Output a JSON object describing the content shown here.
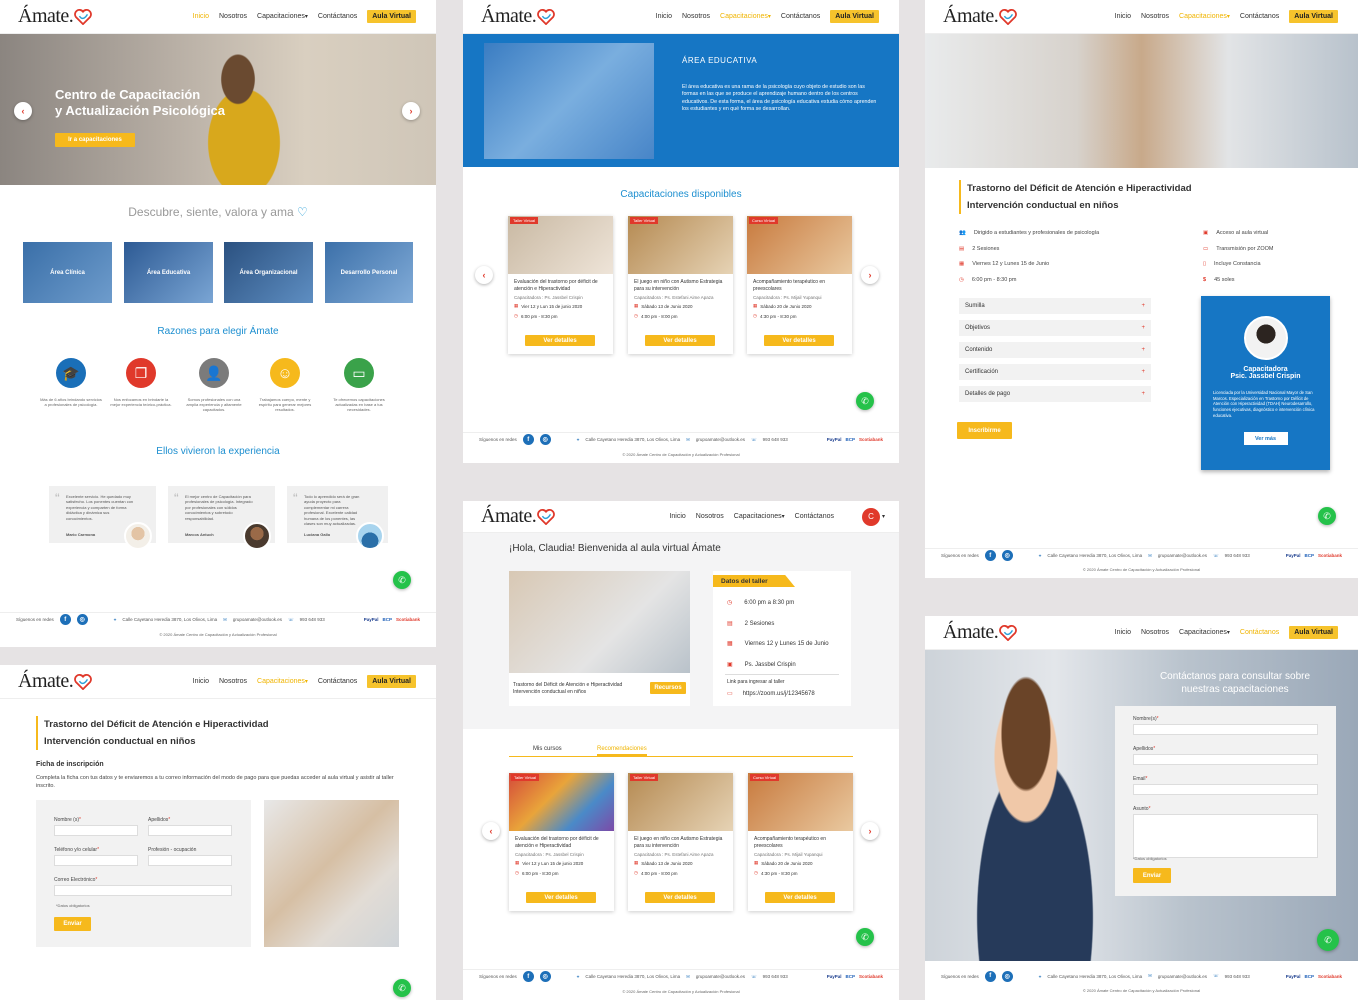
{
  "brand": "Ámate.",
  "nav": {
    "inicio": "Inicio",
    "nosotros": "Nosotros",
    "capacitaciones": "Capacitaciones",
    "contactanos": "Contáctanos",
    "aula": "Aula Virtual"
  },
  "p1": {
    "hero_title_1": "Centro de Capacitación",
    "hero_title_2": "y Actualización Psicológica",
    "hero_btn": "Ir a capacitaciones",
    "tagline": "Descubre, siente, valora y ama",
    "areas": [
      "Área Clínica",
      "Área Educativa",
      "Área Organizacional",
      "Desarrollo Personal"
    ],
    "reasons_title": "Razones para elegir Ámate",
    "reasons": [
      {
        "text": "Más de 6 años brindando servicios a profesionales de psicología.",
        "color": "#1a6fb8"
      },
      {
        "text": "Nos enfocamos en brindarte la mejor experiencia teórico-práctica.",
        "color": "#e0392b"
      },
      {
        "text": "Somos profesionales con una amplia experiencia y altamente capacitados.",
        "color": "#7b7b7b"
      },
      {
        "text": "Trabajamos cuerpo, mente y espíritu para generar mejores resultados.",
        "color": "#f6b91c"
      },
      {
        "text": "Te ofrecemos capacitaciones actualizadas en base a tus necesidades.",
        "color": "#3aa24a"
      }
    ],
    "testimonials_title": "Ellos vivieron la experiencia",
    "testimonials": [
      {
        "text": "Excelente servicio. He quedado muy satisfecho. Los ponentes cuentan con experiencia y comparten de forma didáctica y dinámica sus conocimientos.",
        "name": "Mario Carmona"
      },
      {
        "text": "El mejor centro de Capacitación para profesionales de psicología. Integrado por profesionales con sólidos conocimientos y sobretodo responsabilidad.",
        "name": "Marcos Antuch"
      },
      {
        "text": "Todo lo aprendido será de gran ayuda proyecto para complementar mi carrera profesional. Excelente calidad humana de los ponentes, las clases son muy actualizadas.",
        "name": "Luciana Gallo"
      }
    ]
  },
  "footer": {
    "follow": "Síguenos en redes",
    "address": "Calle Cayetano Heredia 3870, Los Olivos, Lima",
    "email": "grupoamate@outlook.es",
    "phone": "993 648 933",
    "copyright": "© 2020 Ámate Centro de Capacitación y Actualización Profesional",
    "pay": [
      "PayPal",
      "BCP",
      "Scotiabank"
    ]
  },
  "p2": {
    "area_title": "ÁREA EDUCATIVA",
    "area_text": "El área educativa es una rama de la psicología cuyo objeto de estudio son las formas en las que se produce el aprendizaje humano dentro de los centros educativos. De esta forma, el área de psicología educativa estudia cómo aprenden los estudiantes y en qué forma se desarrollan.",
    "courses_title": "Capacitaciones disponibles"
  },
  "courses": [
    {
      "tag": "Taller Virtual",
      "title": "Evaluación del trastorno por déficit de atención e Hiperactividad",
      "cap": "Capacitadora : Ps. Jassbel Crispin",
      "date": "Vier 12 y Lun 15 de junio 2020",
      "time": "6:00 pm - 8:30 pm",
      "btn": "Ver detalles",
      "color": "#c9b9a3"
    },
    {
      "tag": "Taller Virtual",
      "title": "El juego en niño con Autismo Estrategia para su intervención",
      "cap": "Capacitadora : Ps. Estefani Aime Apaza",
      "date": "Sábado 13 de Junio 2020",
      "time": "4:00 pm - 8:00 pm",
      "btn": "Ver detalles",
      "color": "#b58a52"
    },
    {
      "tag": "Curso Virtual",
      "title": "Acompañamiento terapéutico en preescolares",
      "cap": "Capacitadora : Ps. Mijail Yupanqui",
      "date": "Sábado 20 de Junio 2020",
      "time": "4:30 pm - 8:30 pm",
      "btn": "Ver detalles",
      "color": "#c87a3e"
    }
  ],
  "p3": {
    "title_1": "Trastorno del Déficit de Atención e Hiperactividad",
    "title_2": "Intervención conductual en niños",
    "left_info": [
      "Dirigido a estudiantes y profesionales de psicología",
      "2 Sesiones",
      "Viernes 12 y Lunes 15 de Junio",
      "6:00 pm - 8:30 pm"
    ],
    "right_info": [
      "Acceso al aula virtual",
      "Transmisión por ZOOM",
      "Incluye Constancia",
      "45 soles"
    ],
    "accordion": [
      "Sumilla",
      "Objetivos",
      "Contenido",
      "Certificación",
      "Detalles de pago"
    ],
    "enroll_btn": "Inscribirme",
    "trainer_label": "Capacitadora",
    "trainer_name": "Psic. Jassbel Crispin",
    "trainer_bio": "Licenciada por la Universidad Nacional Mayor de San Marcos. Especialización en Trastorno por Déficit de Atención con Hiperactividad (TDAH) Neurodesarrollo, funciones ejecutivas, diagnóstico e intervención clínica educativa.",
    "trainer_btn": "Ver más"
  },
  "p4": {
    "title_1": "Trastorno del Déficit de Atención e Hiperactividad",
    "title_2": "Intervención conductual en niños",
    "form_title": "Ficha de inscripción",
    "form_text": "Completa la ficha con tus datos y te enviaremos a tu correo información del modo de pago para que puedas acceder al aula virtual y asistir al taller inscrito.",
    "fields": {
      "nombre": "Nombre (s)",
      "apellidos": "Apellidos",
      "telefono": "Teléfono y/o celular",
      "profesion": "Profesión - ocupación",
      "correo": "Correo Electrónico"
    },
    "note": "*Datos obligatorios",
    "submit": "Enviar"
  },
  "p5": {
    "welcome": "¡Hola, Claudia! Bienvenida al aula virtual Ámate",
    "avatar": "C",
    "course_title": "Trastorno del Déficit de Atención e Hiperactividad Intervención conductual en niños",
    "resources_btn": "Recursos",
    "details_title": "Datos del taller",
    "details": [
      "6:00 pm a 8:30 pm",
      "2 Sesiones",
      "Viernes 12 y Lunes 15 de Junio",
      "Ps. Jassbel Crispin"
    ],
    "link_label": "Link para ingresar al taller",
    "link": "https://zoom.us/j/12345678",
    "tabs": [
      "Mis cursos",
      "Recomendaciones"
    ]
  },
  "p6": {
    "heading_1": "Contáctanos para consultar sobre",
    "heading_2": "nuestras capacitaciones",
    "fields": [
      "Nombre(s)",
      "Apellidos",
      "Email",
      "Asunto"
    ],
    "note": "*Datos obligatorios",
    "submit": "Enviar"
  }
}
